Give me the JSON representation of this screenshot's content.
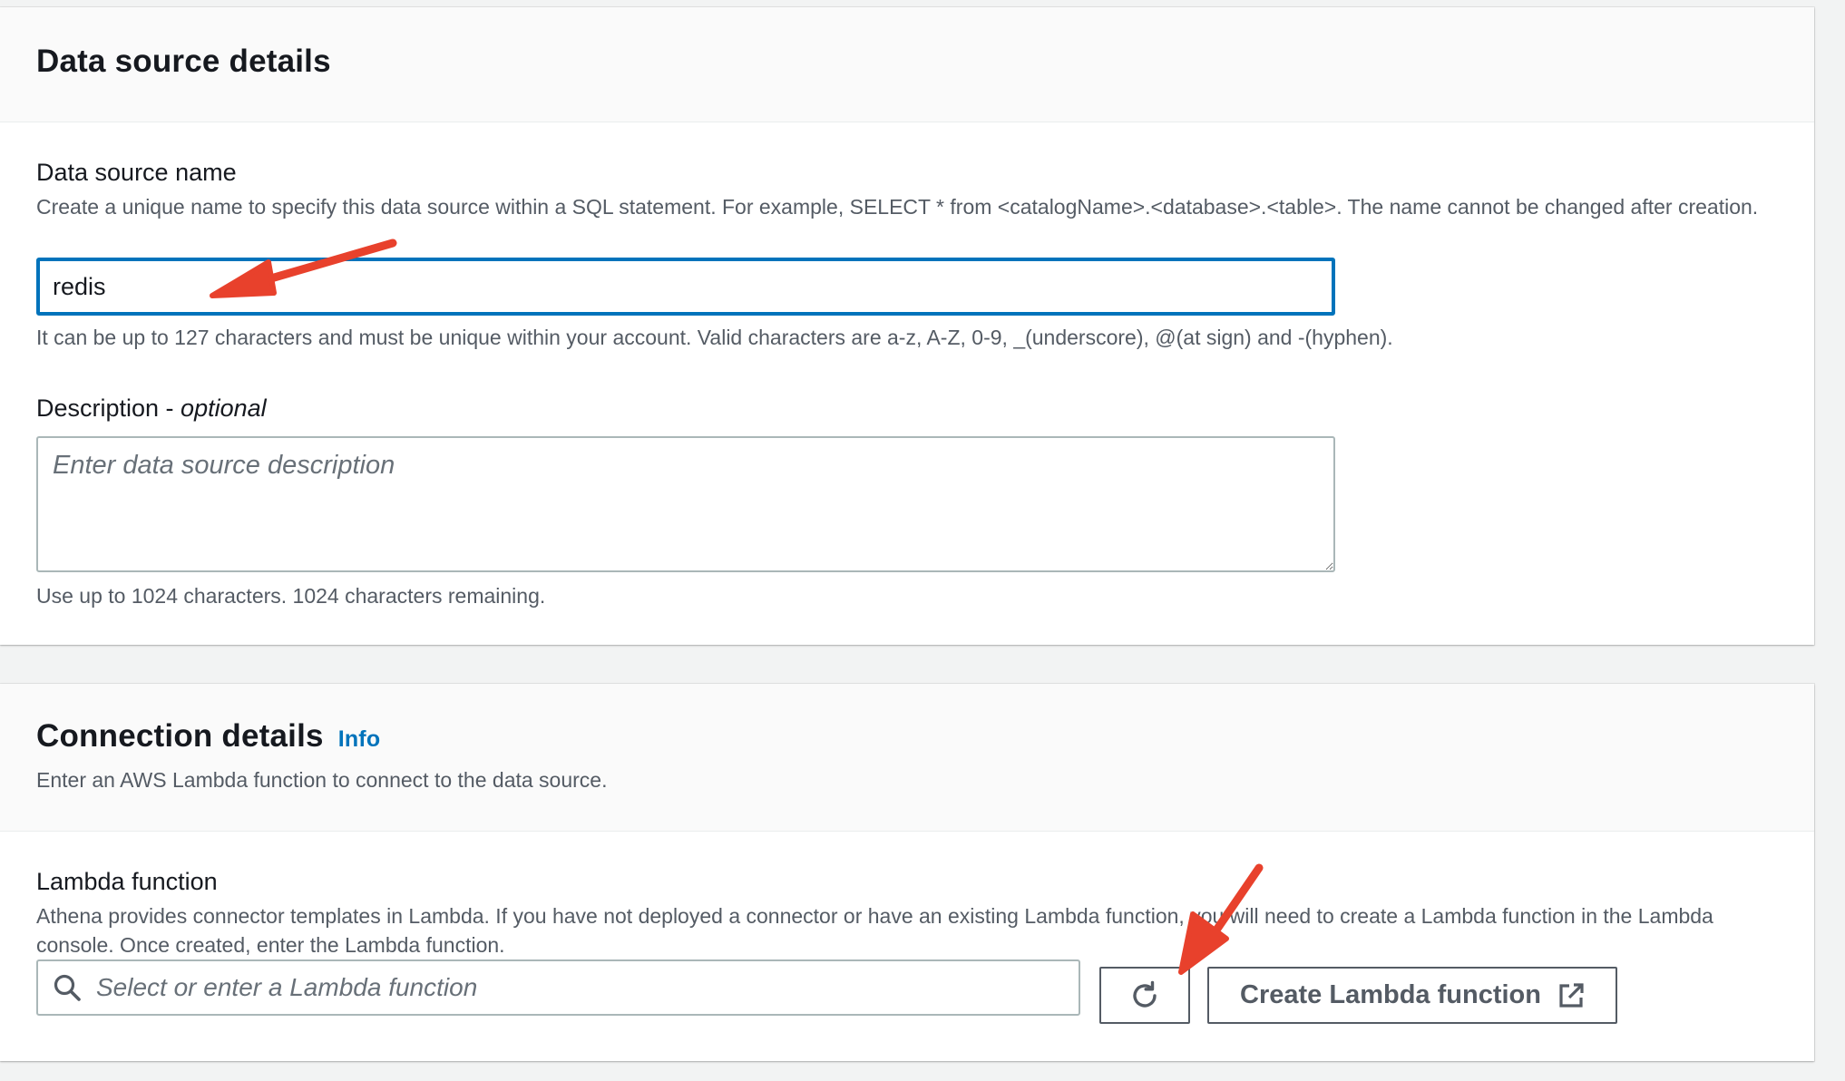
{
  "data_source_details": {
    "title": "Data source details",
    "name_field": {
      "label": "Data source name",
      "description": "Create a unique name to specify this data source within a SQL statement. For example, SELECT * from <catalogName>.<database>.<table>. The name cannot be changed after creation.",
      "value": "redis",
      "constraint": "It can be up to 127 characters and must be unique within your account. Valid characters are a-z, A-Z, 0-9, _(underscore), @(at sign) and -(hyphen)."
    },
    "description_field": {
      "label": "Description - ",
      "label_optional": "optional",
      "placeholder": "Enter data source description",
      "hint": "Use up to 1024 characters. 1024 characters remaining."
    }
  },
  "connection_details": {
    "title": "Connection details",
    "info_link": "Info",
    "subtitle": "Enter an AWS Lambda function to connect to the data source.",
    "lambda_field": {
      "label": "Lambda function",
      "description": "Athena provides connector templates in Lambda. If you have not deployed a connector or have an existing Lambda function, you will need to create a Lambda function in the Lambda console. Once created, enter the Lambda function.",
      "placeholder": "Select or enter a Lambda function",
      "search_icon": "search-icon",
      "refresh_icon": "refresh-icon",
      "create_button_label": "Create Lambda function",
      "external_icon": "external-link-icon"
    }
  },
  "colors": {
    "focus_border": "#0073bb",
    "link": "#0073bb",
    "annotation_arrow": "#e8412c"
  }
}
